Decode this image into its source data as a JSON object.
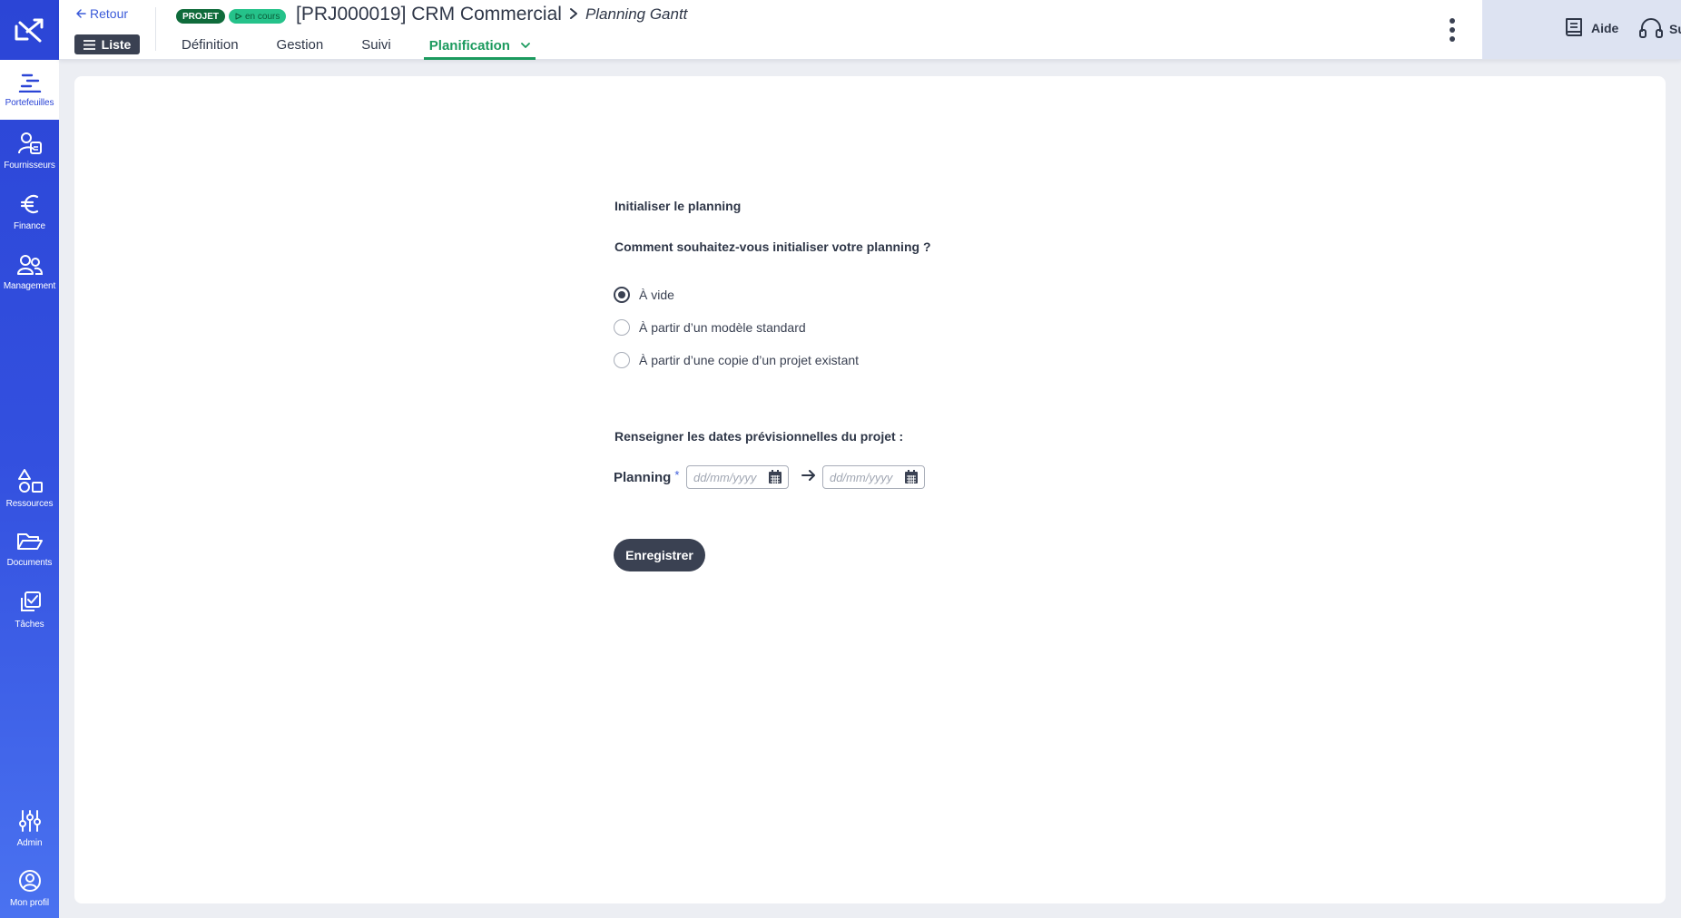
{
  "sidebar": {
    "items": [
      {
        "label": "Portefeuilles",
        "icon": "portfolio-gantt-icon"
      },
      {
        "label": "Fournisseurs",
        "icon": "supplier-icon"
      },
      {
        "label": "Finance",
        "icon": "euro-icon"
      },
      {
        "label": "Management",
        "icon": "people-icon"
      },
      {
        "label": "Ressources",
        "icon": "shapes-icon"
      },
      {
        "label": "Documents",
        "icon": "folder-icon"
      },
      {
        "label": "Tâches",
        "icon": "task-check-icon"
      },
      {
        "label": "Admin",
        "icon": "sliders-icon"
      },
      {
        "label": "Mon profil",
        "icon": "user-circle-icon"
      }
    ]
  },
  "header": {
    "back_label": "Retour",
    "liste_label": "Liste",
    "badge_type": "PROJET",
    "badge_status": "en cours",
    "project_title": "[PRJ000019] CRM Commercial",
    "sub_title": "Planning Gantt",
    "tabs": [
      {
        "label": "Définition"
      },
      {
        "label": "Gestion"
      },
      {
        "label": "Suivi"
      },
      {
        "label": "Planification",
        "active": true
      }
    ],
    "help_label": "Aide",
    "support_label": "Support"
  },
  "form": {
    "init_title": "Initialiser le planning",
    "question": "Comment souhaitez-vous initialiser votre planning ?",
    "options": [
      {
        "label": "À vide",
        "checked": true
      },
      {
        "label": "À partir d’un modèle standard",
        "checked": false
      },
      {
        "label": "À partir d’une copie d’un projet existant",
        "checked": false
      }
    ],
    "dates_title": "Renseigner les dates prévisionnelles du projet :",
    "planning_label": "Planning",
    "required_mark": "*",
    "start_placeholder": "dd/mm/yyyy",
    "end_placeholder": "dd/mm/yyyy",
    "save_label": "Enregistrer"
  },
  "colors": {
    "sidebar": "#2b45d6",
    "accent_green": "#1b9a5e",
    "dark_button": "#3a4152",
    "link_blue": "#3b5bd9"
  }
}
